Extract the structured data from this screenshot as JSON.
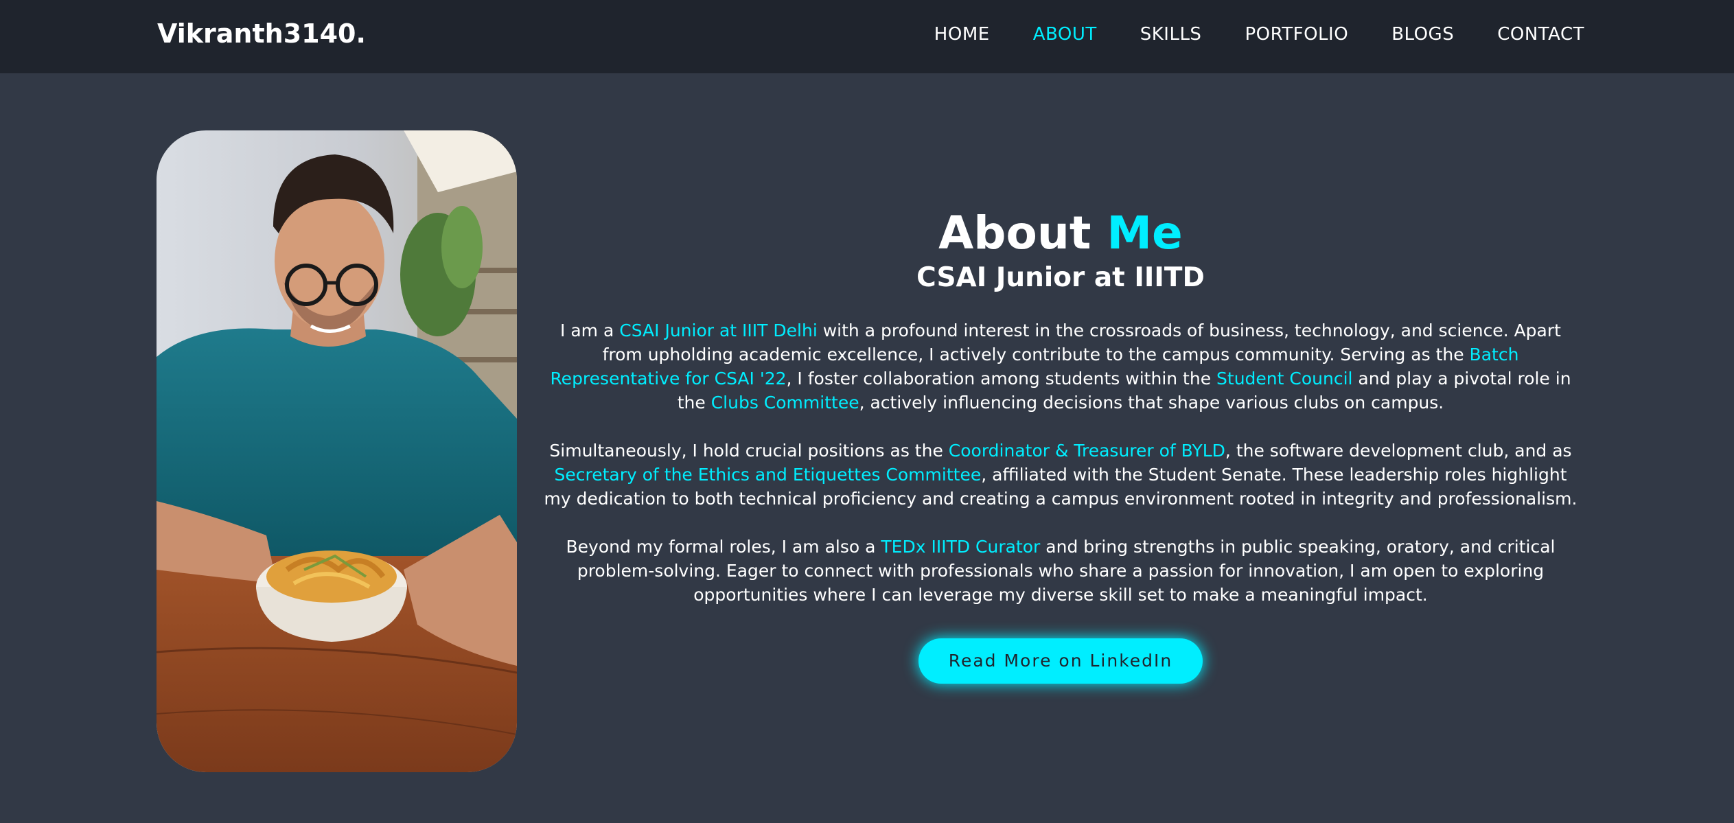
{
  "header": {
    "logo": "Vikranth3140.",
    "nav": [
      {
        "label": "HOME",
        "active": false
      },
      {
        "label": "ABOUT",
        "active": true
      },
      {
        "label": "SKILLS",
        "active": false
      },
      {
        "label": "PORTFOLIO",
        "active": false
      },
      {
        "label": "BLOGS",
        "active": false
      },
      {
        "label": "CONTACT",
        "active": false
      }
    ]
  },
  "about": {
    "title_main": "About",
    "title_accent": "Me",
    "subtitle": "CSAI Junior at IIITD",
    "p1": {
      "t1": "I am a ",
      "h1": "CSAI Junior at IIIT Delhi",
      "t2": " with a profound interest in the crossroads of business, technology, and science. Apart from upholding academic excellence, I actively contribute to the campus community. Serving as the ",
      "h2": "Batch Representative for CSAI '22",
      "t3": ", I foster collaboration among students within the ",
      "h3": "Student Council",
      "t4": " and play a pivotal role in the ",
      "h4": "Clubs Committee",
      "t5": ", actively influencing decisions that shape various clubs on campus."
    },
    "p2": {
      "t1": "Simultaneously, I hold crucial positions as the ",
      "h1": "Coordinator & Treasurer of BYLD",
      "t2": ", the software development club, and as ",
      "h2": "Secretary of the Ethics and Etiquettes Committee",
      "t3": ", affiliated with the Student Senate. These leadership roles highlight my dedication to both technical proficiency and creating a campus environment rooted in integrity and professionalism."
    },
    "p3": {
      "t1": "Beyond my formal roles, I am also a ",
      "h1": "TEDx IIITD Curator",
      "t2": " and bring strengths in public speaking, oratory, and critical problem-solving. Eager to connect with professionals who share a passion for innovation, I am open to exploring opportunities where I can leverage my diverse skill set to make a meaningful impact."
    },
    "button_label": "Read More on LinkedIn"
  },
  "colors": {
    "accent": "#00eeff",
    "background": "#323946",
    "header_bg": "#1f242d"
  }
}
